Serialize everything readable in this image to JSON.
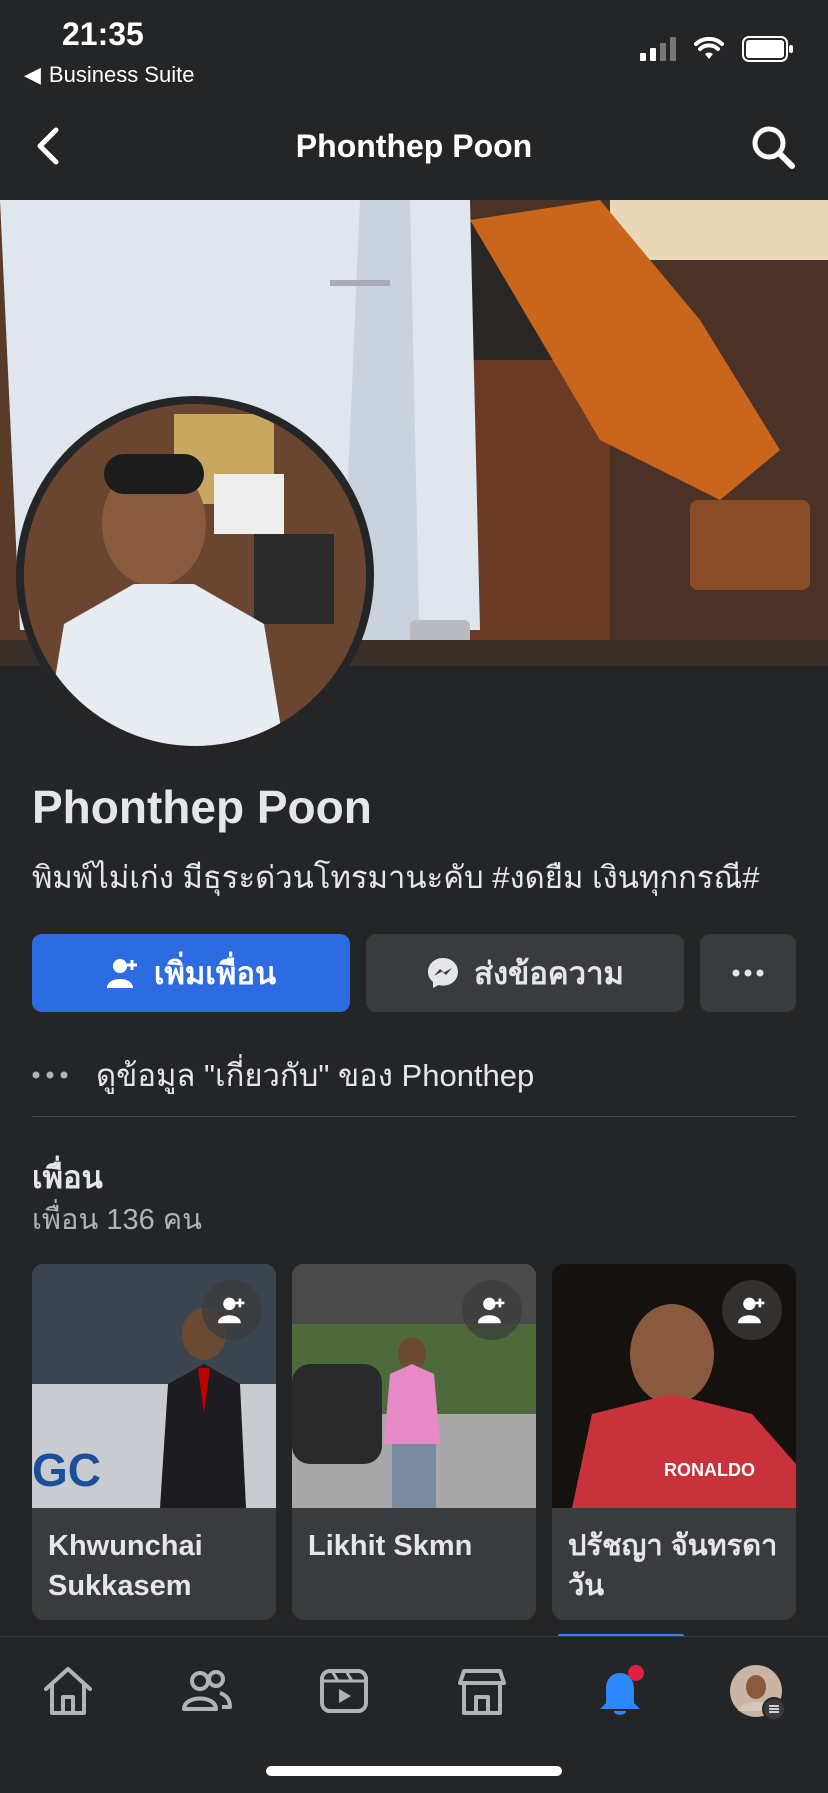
{
  "status_bar": {
    "time": "21:35",
    "back_app": "Business Suite"
  },
  "header": {
    "title": "Phonthep Poon"
  },
  "profile": {
    "name": "Phonthep Poon",
    "bio": "พิมพ์ไม่เก่ง มีธุระด่วนโทรมานะคับ #งดยืม เงินทุกกรณี#",
    "add_friend_label": "เพิ่มเพื่อน",
    "message_label": "ส่งข้อความ",
    "about_link": "ดูข้อมูล \"เกี่ยวกับ\" ของ Phonthep"
  },
  "friends": {
    "title": "เพื่อน",
    "count_text": "เพื่อน 136 คน",
    "items": [
      {
        "name": "Khwunchai Sukkasem"
      },
      {
        "name": "Likhit Skmn"
      },
      {
        "name": "ปรัชญา จันทรดาวัน"
      }
    ]
  },
  "tabbar": {
    "items": [
      "home-icon",
      "friends-icon",
      "watch-icon",
      "marketplace-icon",
      "notifications-icon",
      "profile-menu"
    ],
    "active": "notifications-icon"
  },
  "colors": {
    "background": "#242526",
    "primary": "#2d6ce0",
    "accent_blue": "#2d88ff",
    "notification_dot": "#e41e3f"
  }
}
